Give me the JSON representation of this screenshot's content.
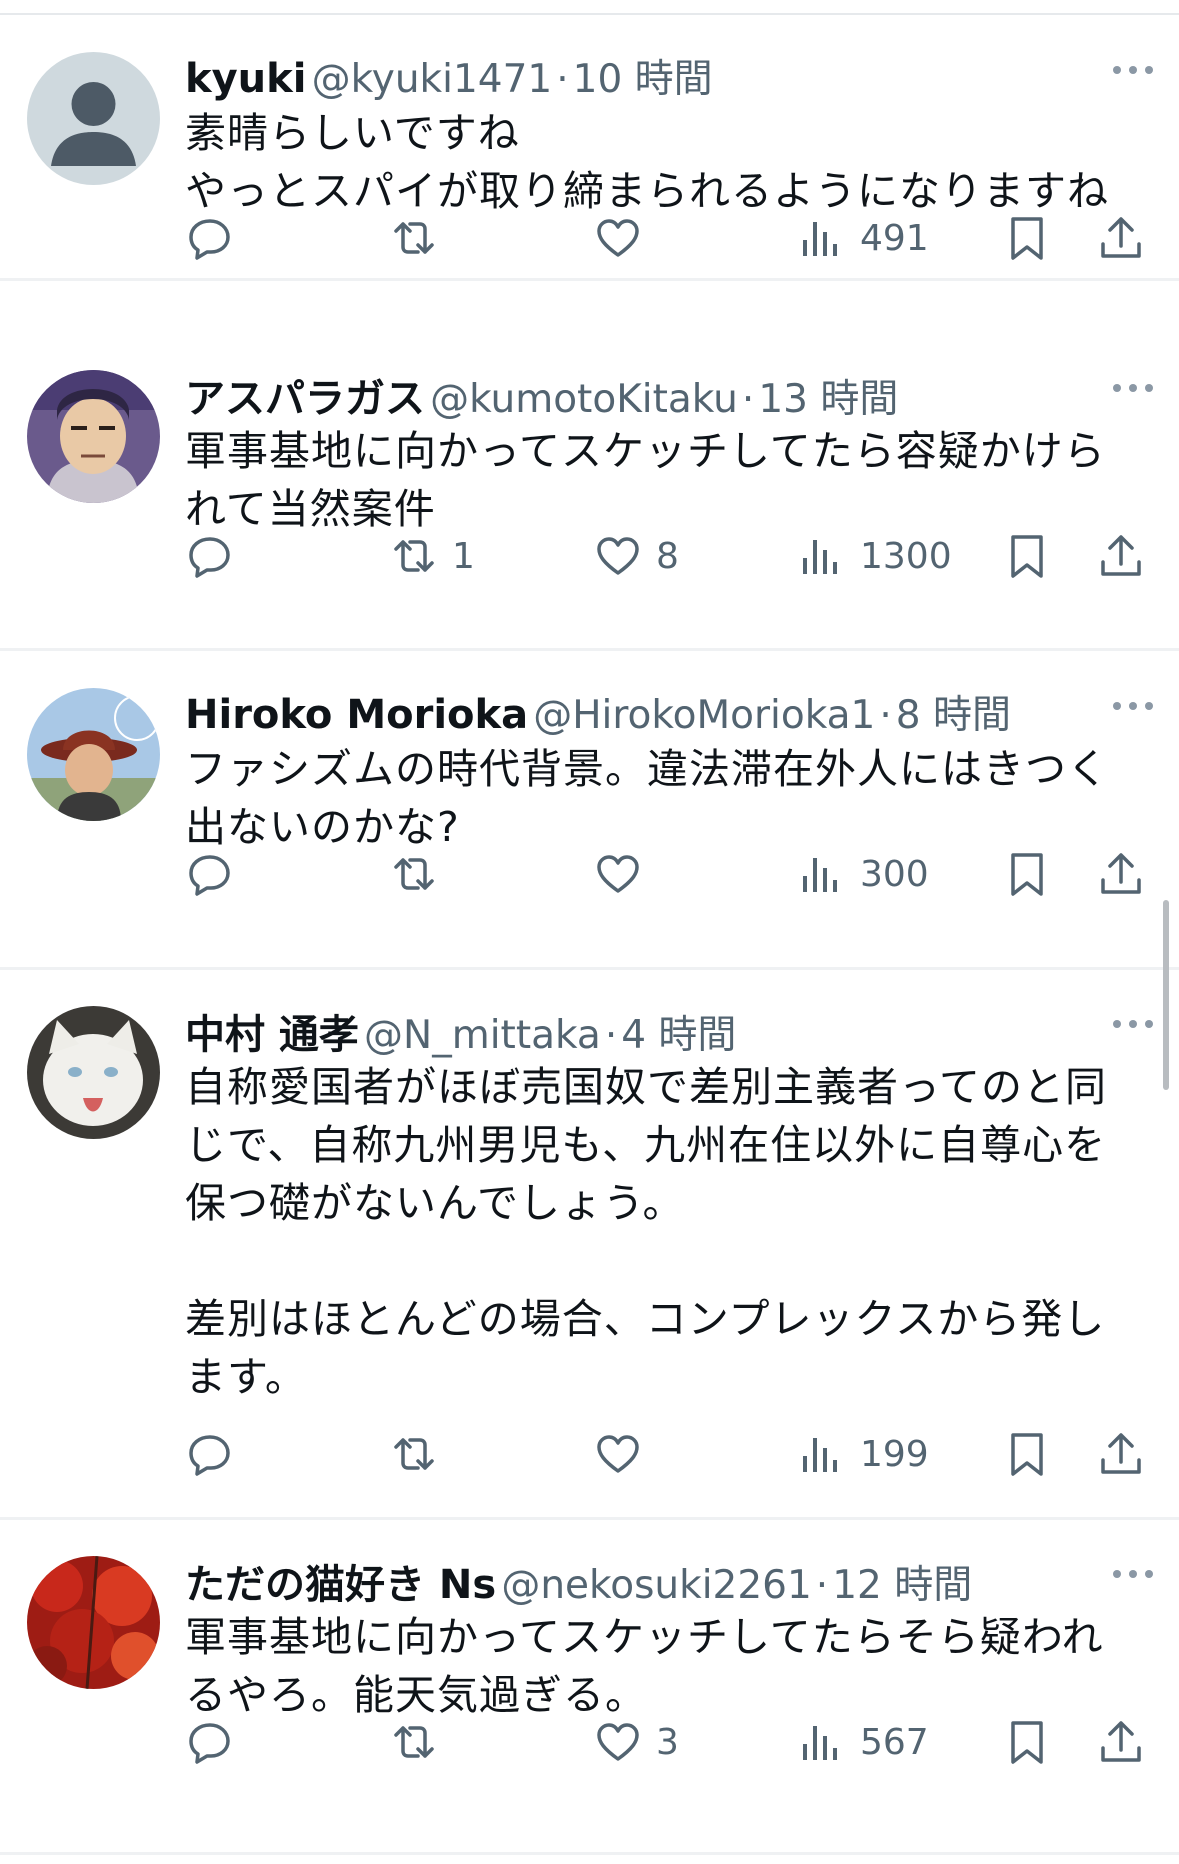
{
  "tweets": [
    {
      "name": "kyuki",
      "handle": "@kyuki1471",
      "time": "10 時間",
      "text": "素晴らしいですね\nやっとスパイが取り締まられるようになりますね",
      "replies": "",
      "retweets": "",
      "likes": "",
      "views": "491",
      "avatar": "default-profile-avatar"
    },
    {
      "name": "アスパラガス",
      "handle": "@kumotoKitaku",
      "time": "13 時間",
      "text": "軍事基地に向かってスケッチしてたら容疑かけら\nれて当然案件",
      "replies": "",
      "retweets": "1",
      "likes": "8",
      "views": "1300",
      "avatar": "anime-character-avatar"
    },
    {
      "name": "Hiroko Morioka",
      "handle": "@HirokoMorioka1",
      "time": "8 時間",
      "text": "ファシズムの時代背景。違法滞在外人にはきつく\n出ないのかな?",
      "replies": "",
      "retweets": "",
      "likes": "",
      "views": "300",
      "avatar": "woman-with-hat-avatar"
    },
    {
      "name": "中村 通孝",
      "handle": "@N_mittaka",
      "time": "4 時間",
      "text": "自称愛国者がほぼ売国奴で差別主義者ってのと同\nじで、自称九州男児も、九州在住以外に自尊心を\n保つ礎がないんでしょう。\n\n差別はほとんどの場合、コンプレックスから発し\nます。",
      "replies": "",
      "retweets": "",
      "likes": "",
      "views": "199",
      "avatar": "white-cat-avatar"
    },
    {
      "name": "ただの猫好き Ns",
      "handle": "@nekosuki2261",
      "time": "12 時間",
      "text": "軍事基地に向かってスケッチしてたらそら疑われ\nるやろ。能天気過ぎる。",
      "replies": "",
      "retweets": "",
      "likes": "3",
      "views": "567",
      "avatar": "red-autumn-leaves-avatar"
    }
  ],
  "separator": "·",
  "icons": {
    "reply": "reply-icon",
    "retweet": "retweet-icon",
    "like": "heart-icon",
    "views": "views-icon",
    "bookmark": "bookmark-icon",
    "share": "share-icon",
    "more": "more-icon"
  },
  "colors": {
    "text": "#0f1419",
    "secondary": "#536471",
    "divider": "#eff1f3"
  }
}
